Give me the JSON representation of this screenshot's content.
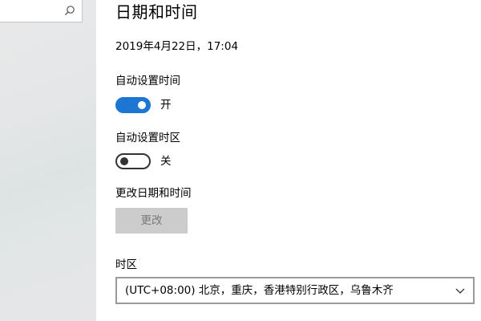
{
  "search": {
    "icon": "search-icon"
  },
  "page": {
    "title": "日期和时间",
    "current_datetime": "2019年4月22日，17:04"
  },
  "auto_time": {
    "label": "自动设置时间",
    "state_label": "开",
    "on": true
  },
  "auto_timezone": {
    "label": "自动设置时区",
    "state_label": "关",
    "on": false
  },
  "change_datetime": {
    "label": "更改日期和时间",
    "button_label": "更改",
    "enabled": false
  },
  "timezone": {
    "label": "时区",
    "value": "(UTC+08:00) 北京，重庆，香港特别行政区，乌鲁木齐",
    "icon": "chevron-down-icon"
  },
  "colors": {
    "accent": "#1e76d3",
    "disabled_button_bg": "#cccccc",
    "disabled_button_text": "#7a7a7a"
  }
}
